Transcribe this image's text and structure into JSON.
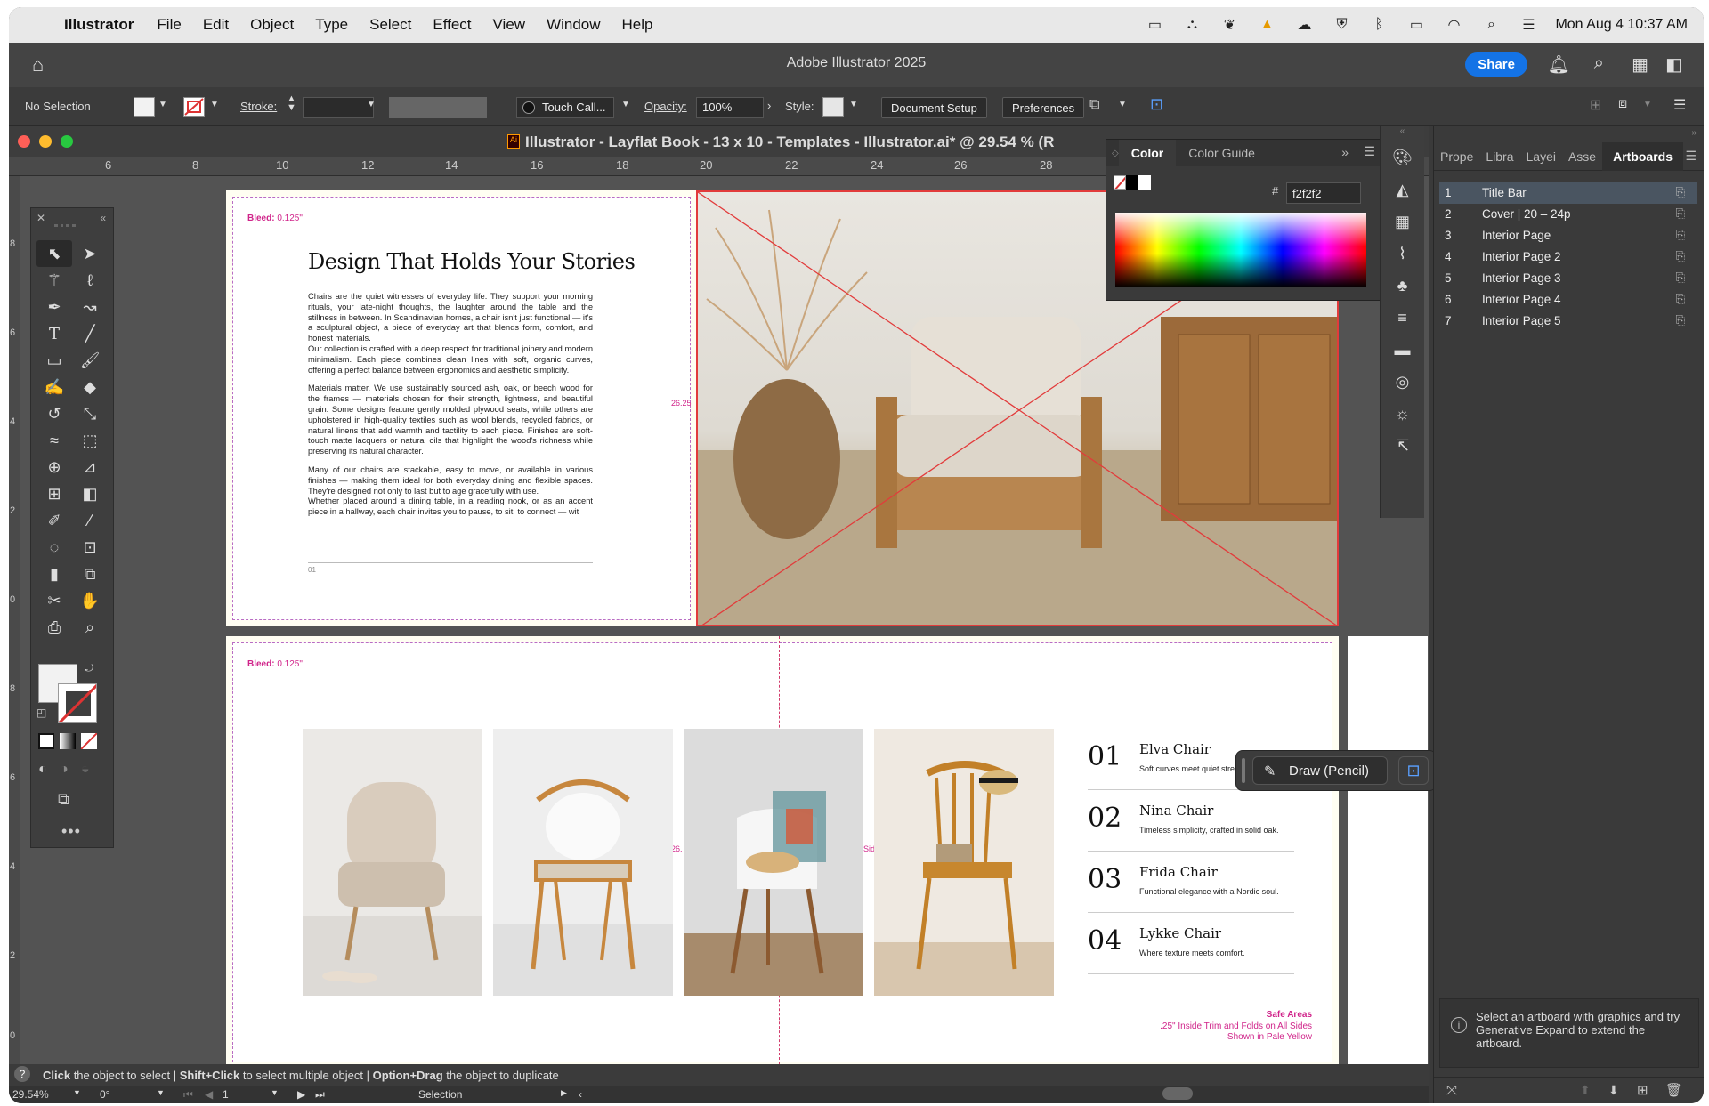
{
  "menubar": {
    "app": "Illustrator",
    "items": [
      "File",
      "Edit",
      "Object",
      "Type",
      "Select",
      "Effect",
      "View",
      "Window",
      "Help"
    ],
    "datetime": "Mon Aug 4  10:37 AM"
  },
  "window": {
    "title": "Adobe Illustrator 2025",
    "share": "Share",
    "doc_title": "Illustrator - Layflat Book  -  13 x 10  -  Templates  -  Illustrator.ai* @ 29.54 % (R"
  },
  "controlbar": {
    "selection": "No Selection",
    "stroke_label": "Stroke:",
    "brush": "Touch Call...",
    "opacity_label": "Opacity:",
    "opacity_value": "100%",
    "style_label": "Style:",
    "document_setup": "Document Setup",
    "preferences": "Preferences"
  },
  "ruler": [
    "6",
    "8",
    "10",
    "12",
    "14",
    "16",
    "18",
    "20",
    "22",
    "24",
    "26",
    "28"
  ],
  "vruler": [
    "8",
    "6",
    "4",
    "2",
    "0",
    "8",
    "6",
    "4",
    "2",
    "0"
  ],
  "color_panel": {
    "tabs": [
      "Color",
      "Color Guide"
    ],
    "hex_label": "#",
    "hex_value": "f2f2f2"
  },
  "page1": {
    "bleed_label": "Bleed:",
    "bleed_value": "0.125\"",
    "heading": "Design That Holds Your Stories",
    "paragraphs": [
      "Chairs are the quiet witnesses of everyday life. They support your morning rituals, your late-night thoughts, the laughter around the table and the stillness in between. In Scandinavian homes, a chair isn't just functional — it's a sculptural object, a piece of everyday art that blends form, comfort, and honest materials.\nOur collection is crafted with a deep respect for traditional joinery and modern minimalism. Each piece combines clean lines with soft, organic curves, offering a perfect balance between ergonomics and aesthetic simplicity.",
      "Materials matter. We use sustainably sourced ash, oak, or beech wood for the frames — materials chosen for their strength, lightness, and beautiful grain. Some designs feature gently molded plywood seats, while others are upholstered in high-quality textiles such as wool blends, recycled fabrics, or natural linens that add warmth and tactility to each piece. Finishes are soft-touch matte lacquers or natural oils that highlight the wood's richness while preserving its natural character.",
      "Many of our chairs are stackable, easy to move, or available in various finishes — making them ideal for both everyday dining and flexible spaces. They're designed not only to last but to age gracefully with use.\nWhether placed around a dining table, in a reading nook, or as an accent piece in a hallway, each chair invites you to pause, to sit, to connect — wit"
    ],
    "page_number": "01",
    "gutter_mark": "26.25"
  },
  "page2": {
    "bleed_label": "Bleed:",
    "bleed_value": "0.125\"",
    "gutter_mark": "26.",
    "side_mark": "Side",
    "products": [
      {
        "num": "01",
        "name": "Elva Chair",
        "desc": "Soft curves meet quiet stre"
      },
      {
        "num": "02",
        "name": "Nina Chair",
        "desc": "Timeless simplicity, crafted in solid oak."
      },
      {
        "num": "03",
        "name": "Frida Chair",
        "desc": "Functional elegance with a Nordic soul."
      },
      {
        "num": "04",
        "name": "Lykke Chair",
        "desc": "Where texture meets comfort."
      }
    ],
    "safe_title": "Safe Areas",
    "safe_line1": ".25\" Inside Trim and Folds on All Sides",
    "safe_line2": "Shown in Pale Yellow"
  },
  "pencil": {
    "label": "Draw (Pencil)"
  },
  "status": {
    "hint_parts": [
      {
        "b": "Click",
        "t": " the object to select  |  "
      },
      {
        "b": "Shift+Click",
        "t": " to select multiple object  |  "
      },
      {
        "b": "Option+Drag",
        "t": " the object to duplicate"
      }
    ],
    "zoom": "29.54%",
    "rotation": "0°",
    "artboard_num": "1",
    "tool": "Selection"
  },
  "right_panel": {
    "tabs": [
      "Prope",
      "Libra",
      "Layei",
      "Asse",
      "Artboards"
    ],
    "artboards": [
      {
        "n": "1",
        "name": "Title Bar"
      },
      {
        "n": "2",
        "name": "Cover  |  20 – 24p"
      },
      {
        "n": "3",
        "name": "Interior Page"
      },
      {
        "n": "4",
        "name": "Interior Page 2"
      },
      {
        "n": "5",
        "name": "Interior Page 3"
      },
      {
        "n": "6",
        "name": "Interior Page 4"
      },
      {
        "n": "7",
        "name": "Interior Page 5"
      }
    ],
    "info": "Select an artboard with graphics and try Generative Expand to extend the artboard."
  },
  "colors": {
    "accent": "#1473e6",
    "bleed": "#d0248a",
    "selection_row": "#4a5561"
  }
}
